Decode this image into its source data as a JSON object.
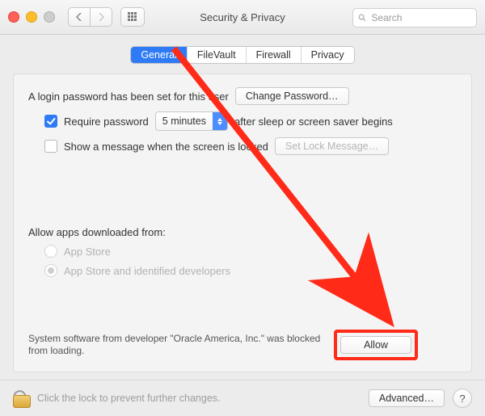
{
  "window": {
    "title": "Security & Privacy"
  },
  "search": {
    "placeholder": "Search"
  },
  "tabs": {
    "general": "General",
    "filevault": "FileVault",
    "firewall": "Firewall",
    "privacy": "Privacy"
  },
  "general": {
    "login_password_text": "A login password has been set for this user",
    "change_password_label": "Change Password…",
    "require_password_label": "Require password",
    "password_delay_value": "5 minutes",
    "after_sleep_text": "after sleep or screen saver begins",
    "show_message_label": "Show a message when the screen is locked",
    "set_lock_message_label": "Set Lock Message…",
    "allow_apps_heading": "Allow apps downloaded from:",
    "radio_app_store": "App Store",
    "radio_identified": "App Store and identified developers",
    "blocked_text": "System software from developer \"Oracle America, Inc.\" was blocked from loading.",
    "allow_label": "Allow"
  },
  "footer": {
    "lock_text": "Click the lock to prevent further changes.",
    "advanced_label": "Advanced…",
    "help_label": "?"
  },
  "annotation": {
    "color": "#ff2a17"
  }
}
